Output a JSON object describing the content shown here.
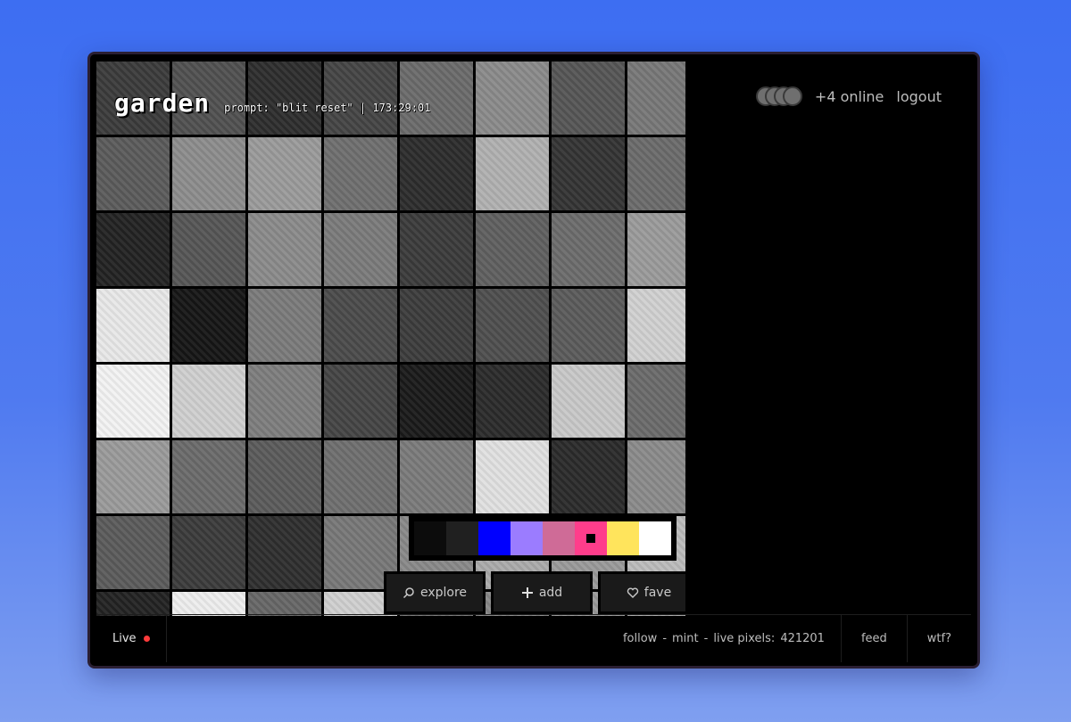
{
  "header": {
    "logo": "garden",
    "prompt": "prompt: \"blit reset\" | 173:29:01"
  },
  "presence": {
    "online_text": "+4 online",
    "logout_label": "logout"
  },
  "palette": {
    "colors": [
      "#0c0c0c",
      "#202020",
      "#0000ff",
      "#9b7cff",
      "#cf6b97",
      "#ff3d8b",
      "#ffe45c",
      "#ffffff"
    ],
    "selected_index": 5
  },
  "actions": {
    "explore_label": "explore",
    "add_label": "add",
    "fave_label": "fave"
  },
  "footer": {
    "live_label": "Live",
    "follow_label": "follow",
    "mint_label": "mint",
    "pixels_label": "live pixels:",
    "pixels_count": "421201",
    "sep": "-",
    "feed_label": "feed",
    "wtf_label": "wtf?"
  },
  "tiles": [
    "#3a3a3a",
    "#505050",
    "#2d2d2d",
    "#444",
    "#6a6a6a",
    "#8a8a8a",
    "#555",
    "#777",
    "#5a5a5a",
    "#8c8c8c",
    "#9a9a9a",
    "#6e6e6e",
    "#2c2c2c",
    "#b0b0b0",
    "#333",
    "#6a6a6a",
    "#222",
    "#555",
    "#8a8a8a",
    "#7a7a7a",
    "#3a3a3a",
    "#5f5f5f",
    "#6b6b6b",
    "#9a9a9a",
    "#e8e8e8",
    "#151515",
    "#7a7a7a",
    "#4a4a4a",
    "#3c3c3c",
    "#4e4e4e",
    "#5a5a5a",
    "#d0d0d0",
    "#f2f2f2",
    "#cfcfcf",
    "#7d7d7d",
    "#444",
    "#1a1a1a",
    "#2a2a2a",
    "#c8c8c8",
    "#6a6a6a",
    "#9a9a9a",
    "#6a6a6a",
    "#5a5a5a",
    "#6e6e6e",
    "#7a7a7a",
    "#e0e0e0",
    "#2a2a2a",
    "#8a8a8a",
    "#5a5a5a",
    "#3a3a3a",
    "#2e2e2e",
    "#777",
    "#888",
    "#aaa",
    "#999",
    "#bbb",
    "#222",
    "#ededed",
    "#666",
    "#cfcfcf",
    "#777",
    "#888",
    "#999",
    "#aaa"
  ]
}
